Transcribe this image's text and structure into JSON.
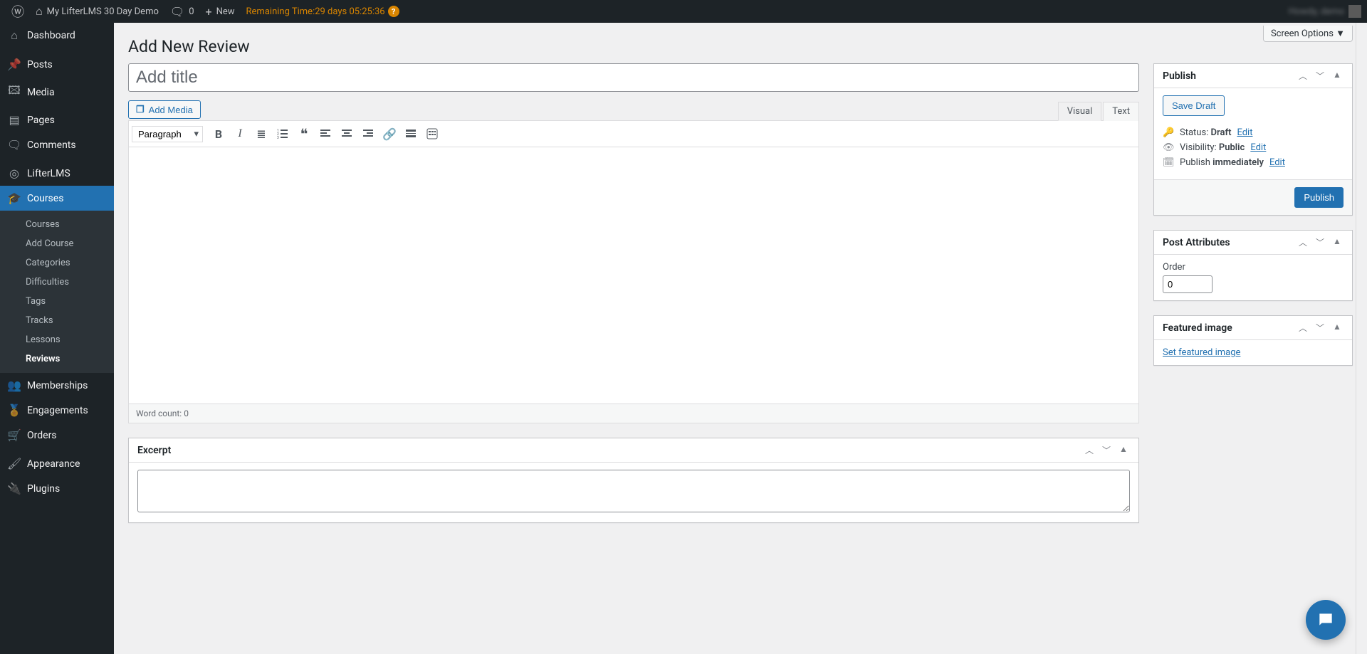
{
  "topbar": {
    "site_name": "My LifterLMS 30 Day Demo",
    "comments_count": "0",
    "new_label": "New",
    "remaining_prefix": "Remaining Time: ",
    "remaining_value": "29 days 05:25:36",
    "user_greeting": "Howdy, demo",
    "help_glyph": "?"
  },
  "screen_options_label": "Screen Options ▼",
  "page_title": "Add New Review",
  "sidebar": {
    "items": [
      {
        "icon": "⌂",
        "label": "Dashboard"
      },
      {
        "sep": true
      },
      {
        "icon": "📌",
        "label": "Posts"
      },
      {
        "icon": "🖾",
        "label": "Media"
      },
      {
        "icon": "▤",
        "label": "Pages"
      },
      {
        "icon": "🗨",
        "label": "Comments"
      },
      {
        "sep": true
      },
      {
        "icon": "◎",
        "label": "LifterLMS"
      },
      {
        "icon": "🎓",
        "label": "Courses",
        "current": true,
        "submenu": [
          {
            "label": "Courses"
          },
          {
            "label": "Add Course"
          },
          {
            "label": "Categories"
          },
          {
            "label": "Difficulties"
          },
          {
            "label": "Tags"
          },
          {
            "label": "Tracks"
          },
          {
            "label": "Lessons"
          },
          {
            "label": "Reviews",
            "active": true
          }
        ]
      },
      {
        "icon": "👥",
        "label": "Memberships"
      },
      {
        "icon": "🏅",
        "label": "Engagements"
      },
      {
        "icon": "🛒",
        "label": "Orders"
      },
      {
        "sep": true
      },
      {
        "icon": "🖌",
        "label": "Appearance"
      },
      {
        "icon": "🔌",
        "label": "Plugins"
      }
    ]
  },
  "editor": {
    "title_placeholder": "Add title",
    "add_media_label": "Add Media",
    "tabs": {
      "visual": "Visual",
      "text": "Text"
    },
    "format_select": "Paragraph",
    "word_count_label": "Word count: ",
    "word_count_value": "0",
    "toolbar_icons": [
      "B",
      "I",
      "bullets",
      "numbers",
      "quote",
      "align-left",
      "align-center",
      "align-right",
      "link",
      "more",
      "keyboard"
    ]
  },
  "publish_box": {
    "title": "Publish",
    "save_draft": "Save Draft",
    "status_label": "Status: ",
    "status_value": "Draft",
    "visibility_label": "Visibility: ",
    "visibility_value": "Public",
    "publish_on_label": "Publish ",
    "publish_on_value": "immediately",
    "edit": "Edit",
    "publish_btn": "Publish"
  },
  "post_attributes": {
    "title": "Post Attributes",
    "order_label": "Order",
    "order_value": "0"
  },
  "featured_image": {
    "title": "Featured image",
    "set_link": "Set featured image"
  },
  "excerpt": {
    "title": "Excerpt"
  }
}
